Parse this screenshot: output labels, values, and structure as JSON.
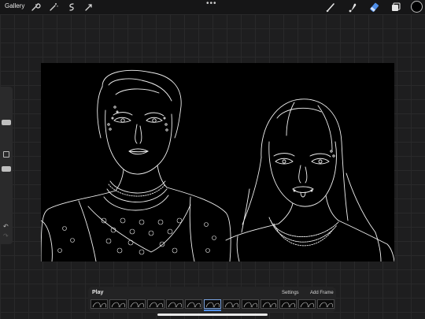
{
  "toolbar": {
    "gallery_label": "Gallery",
    "left_icons": [
      "wrench-icon",
      "magic-wand-icon",
      "selection-icon",
      "transform-icon"
    ],
    "right_icons": [
      "brush-icon",
      "smudge-icon",
      "eraser-icon",
      "layers-icon"
    ],
    "more_label": "•••",
    "active_tool": "eraser",
    "color": "#000000"
  },
  "sidebar": {
    "undo_label": "↶",
    "redo_label": "↷"
  },
  "animation": {
    "play_label": "Play",
    "settings_label": "Settings",
    "add_frame_label": "Add Frame",
    "frame_count": 13,
    "active_frame_index": 6
  },
  "colors": {
    "accent": "#4f8ee8",
    "canvas": "#000000",
    "background": "#1e1e1f"
  }
}
